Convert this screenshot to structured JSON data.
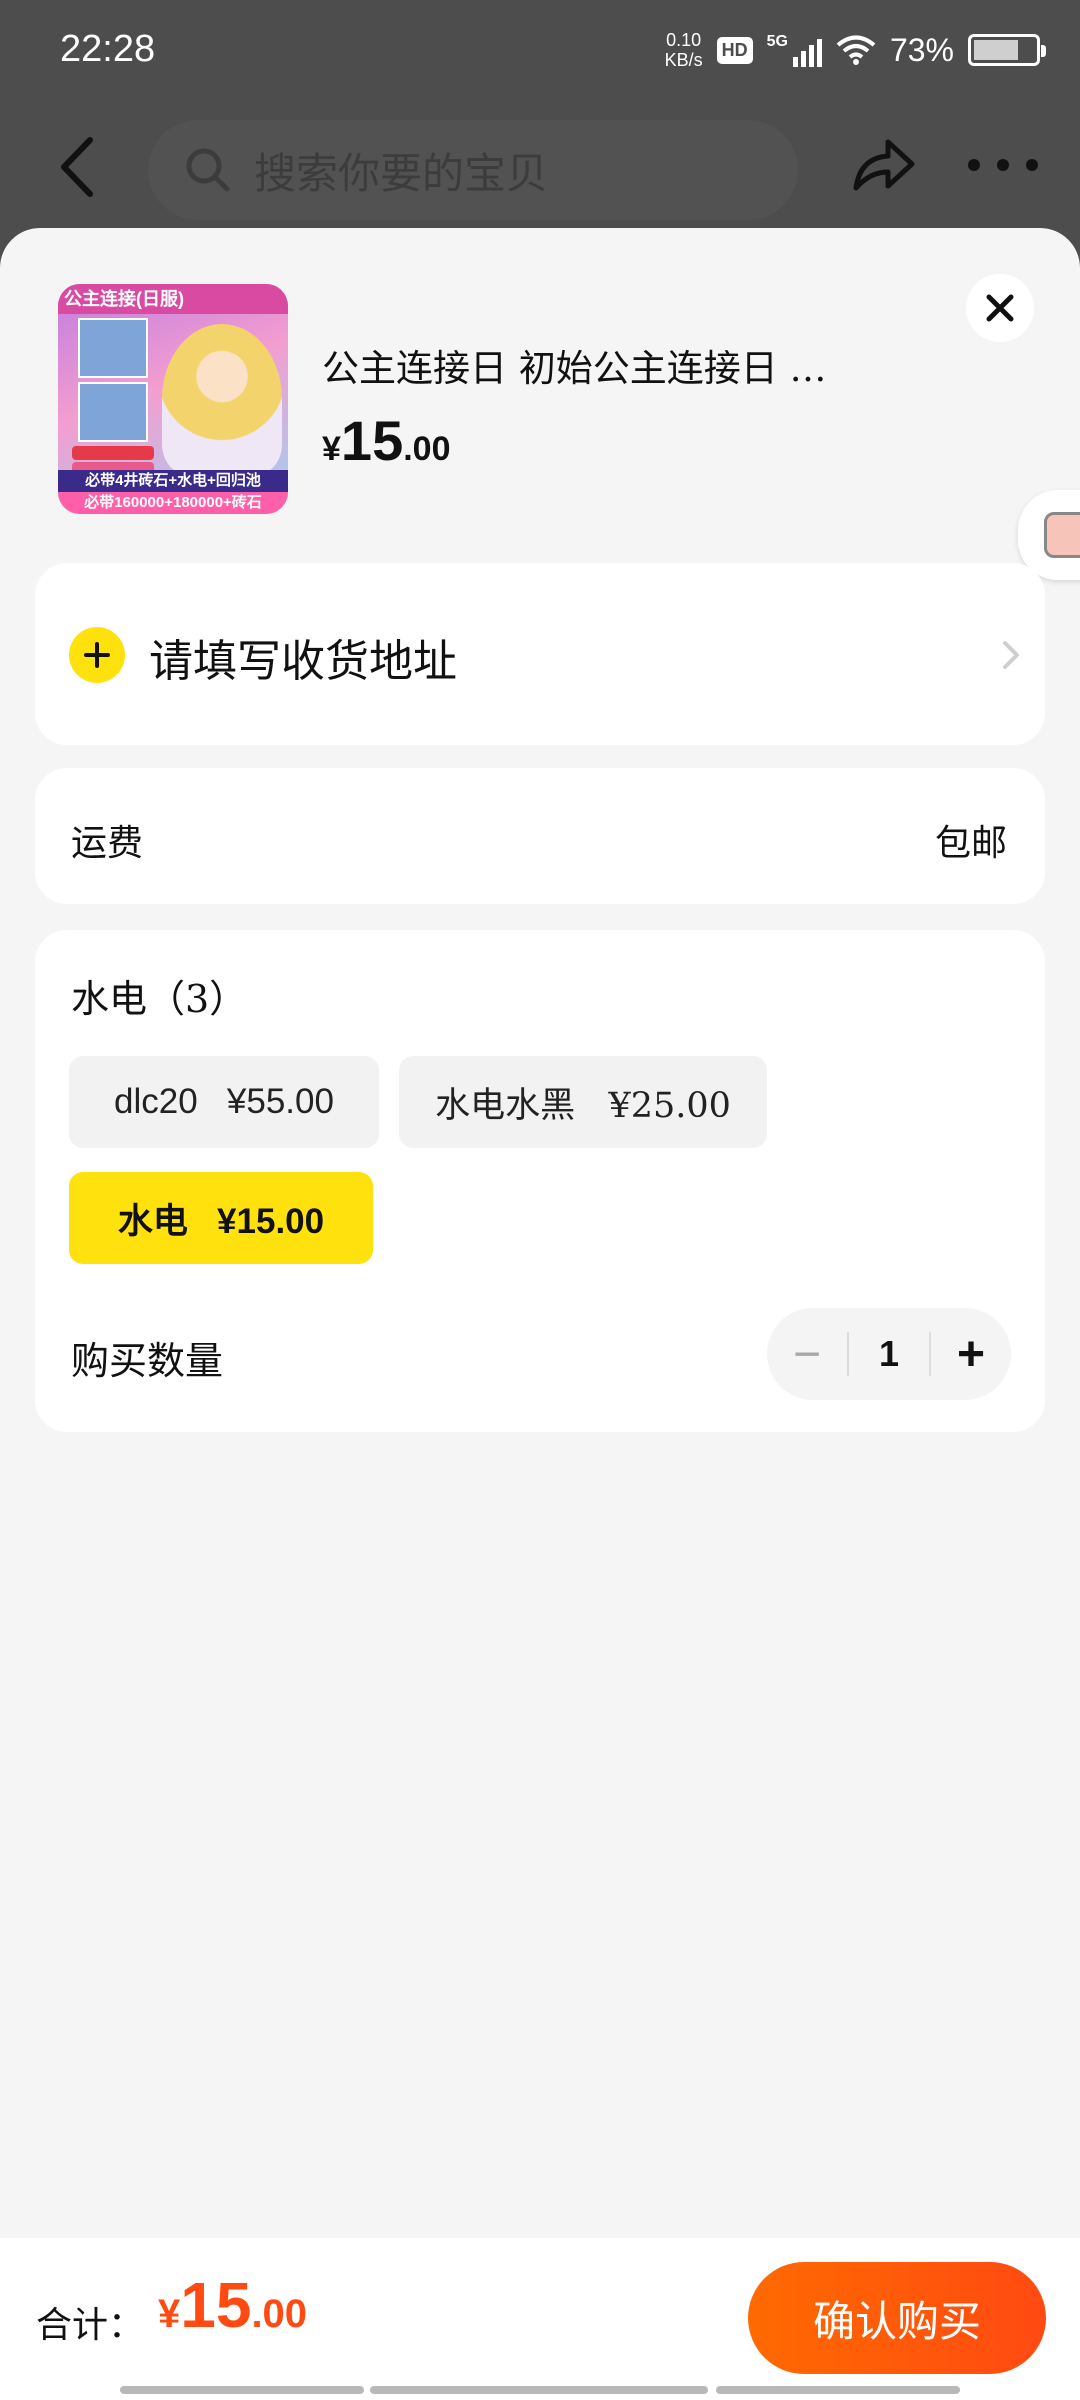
{
  "status_bar": {
    "time": "22:28",
    "net_speed_value": "0.10",
    "net_speed_unit": "KB/s",
    "hd_label": "HD",
    "network_label": "5G",
    "battery_percent_text": "73%",
    "battery_level": 0.73
  },
  "nav": {
    "search_placeholder": "搜索你要的宝贝",
    "back_icon": "chevron-left-icon",
    "share_icon": "share-arrow-icon",
    "more_icon": "more-dots-icon"
  },
  "product": {
    "thumb_header": "公主连接(日服)",
    "thumb_band_1": "必带4井砖石+水电+回归池",
    "thumb_band_2": "必带160000+180000+砖石",
    "title": "公主连接日 初始公主连接日 …",
    "price_symbol": "¥",
    "price_int": "15",
    "price_dec": ".00"
  },
  "address": {
    "label": "请填写收货地址",
    "icon": "plus-icon"
  },
  "shipping": {
    "label": "运费",
    "value": "包邮"
  },
  "spec": {
    "title": "水电（3）",
    "options": [
      {
        "label": "dlc20   ¥55.00",
        "selected": false
      },
      {
        "label": "水电水黑   ¥25.00",
        "selected": false
      },
      {
        "label": "水电   ¥15.00",
        "selected": true
      }
    ],
    "quantity_label": "购买数量",
    "quantity_value": "1",
    "minus_label": "−",
    "plus_label": "+"
  },
  "footer": {
    "total_label": "合计：",
    "total_symbol": "¥",
    "total_int": "15",
    "total_dec": ".00",
    "confirm_label": "确认购买"
  },
  "colors": {
    "accent_yellow": "#ffe20d",
    "price_orange": "#ff4a12",
    "button_gradient_start": "#ff6a00"
  }
}
